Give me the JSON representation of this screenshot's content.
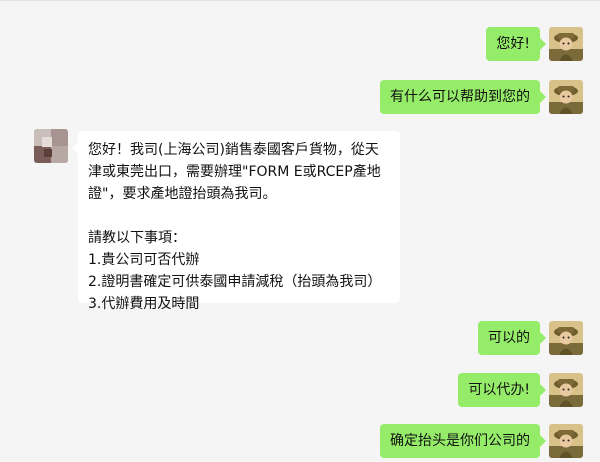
{
  "messages": [
    {
      "side": "me",
      "text": "您好!"
    },
    {
      "side": "me",
      "text": "有什么可以帮助到您的"
    },
    {
      "side": "them",
      "lines": [
        "您好！我司(上海公司)銷售泰國客戶貨物，從天",
        "津或東莞出口，需要辦理\"FORM E或RCEP產地",
        "證\"，要求產地證抬頭為我司。",
        "",
        "請教以下事項：",
        "1.貴公司可否代辦",
        "2.證明書確定可供泰國申請減稅（抬頭為我司）",
        "3.代辦費用及時間"
      ]
    },
    {
      "side": "me",
      "text": "可以的"
    },
    {
      "side": "me",
      "text": "可以代办!"
    },
    {
      "side": "me",
      "text": "确定抬头是你们公司的"
    }
  ],
  "colors": {
    "background": "#f5f5f5",
    "my_bubble": "#95ec69",
    "their_bubble": "#ffffff"
  },
  "icons": {
    "my_avatar": "cartoon-person-avatar-icon",
    "their_avatar": "blurred-avatar-icon"
  }
}
